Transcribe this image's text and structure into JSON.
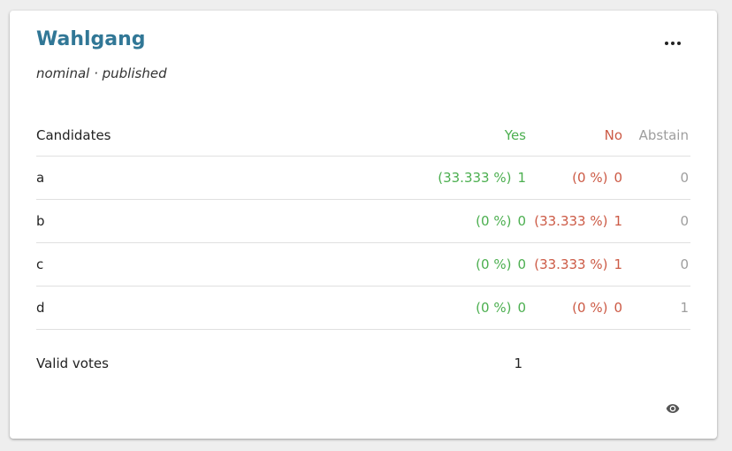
{
  "card": {
    "title": "Wahlgang",
    "subtitle": "nominal · published",
    "menu_icon": "more-horizontal-icon"
  },
  "table": {
    "headers": {
      "candidates": "Candidates",
      "yes": "Yes",
      "no": "No",
      "abstain": "Abstain"
    },
    "rows": [
      {
        "name": "a",
        "yes_pct": "(33.333 %)",
        "yes": "1",
        "no_pct": "(0 %)",
        "no": "0",
        "abstain": "0"
      },
      {
        "name": "b",
        "yes_pct": "(0 %)",
        "yes": "0",
        "no_pct": "(33.333 %)",
        "no": "1",
        "abstain": "0"
      },
      {
        "name": "c",
        "yes_pct": "(0 %)",
        "yes": "0",
        "no_pct": "(33.333 %)",
        "no": "1",
        "abstain": "0"
      },
      {
        "name": "d",
        "yes_pct": "(0 %)",
        "yes": "0",
        "no_pct": "(0 %)",
        "no": "0",
        "abstain": "1"
      }
    ]
  },
  "valid_votes": {
    "label": "Valid votes",
    "value": "1"
  },
  "footer": {
    "visibility_icon": "eye-icon"
  },
  "colors": {
    "title": "#317796",
    "yes": "#4caf50",
    "no": "#cc5a45",
    "abstain": "#9e9e9e"
  }
}
